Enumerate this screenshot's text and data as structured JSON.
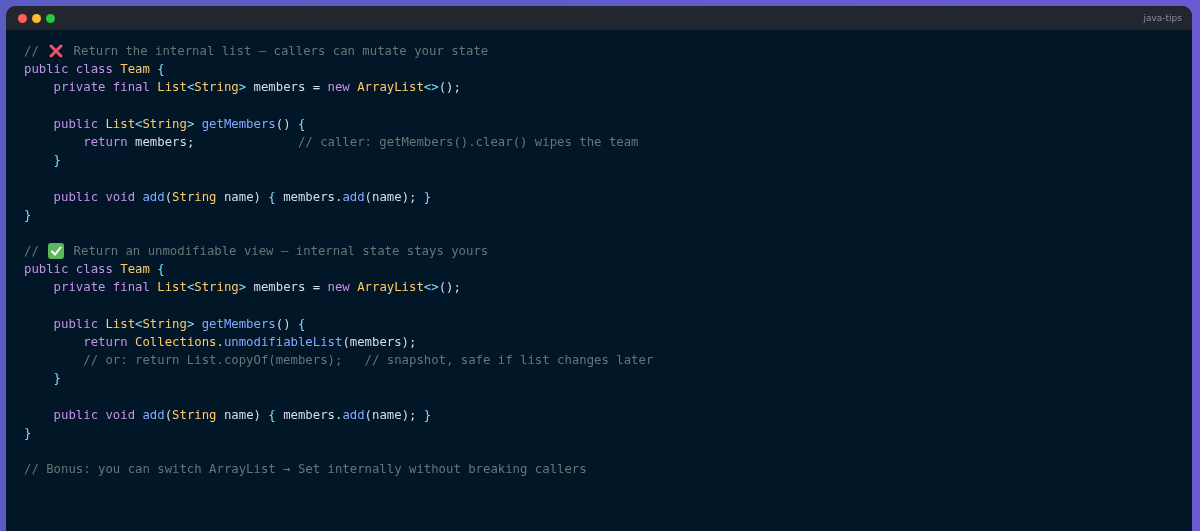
{
  "window": {
    "title": "java-tips"
  },
  "code_blocks": [
    {
      "lines": [
        [
          {
            "kind": "c",
            "text": "// "
          },
          {
            "kind": "cross-icon"
          },
          {
            "kind": "c",
            "text": " Return the internal list — callers can mutate your state"
          }
        ],
        [
          {
            "kind": "k",
            "text": "public class "
          },
          {
            "kind": "t",
            "text": "Team"
          },
          {
            "kind": "p",
            "text": " {"
          }
        ],
        [
          {
            "kind": "k",
            "text": "    private final "
          },
          {
            "kind": "t",
            "text": "List"
          },
          {
            "kind": "p",
            "text": "<"
          },
          {
            "kind": "t",
            "text": "String"
          },
          {
            "kind": "p",
            "text": ">"
          },
          {
            "kind": "n",
            "text": " members = "
          },
          {
            "kind": "k",
            "text": "new "
          },
          {
            "kind": "t",
            "text": "ArrayList"
          },
          {
            "kind": "p",
            "text": "<>"
          },
          {
            "kind": "n",
            "text": "();"
          }
        ]
      ]
    },
    {
      "lines": [
        [
          {
            "kind": "k",
            "text": "    public "
          },
          {
            "kind": "t",
            "text": "List"
          },
          {
            "kind": "p",
            "text": "<"
          },
          {
            "kind": "t",
            "text": "String"
          },
          {
            "kind": "p",
            "text": "> "
          },
          {
            "kind": "f",
            "text": "getMembers"
          },
          {
            "kind": "n",
            "text": "() "
          },
          {
            "kind": "p",
            "text": "{"
          }
        ],
        [
          {
            "kind": "k",
            "text": "        return "
          },
          {
            "kind": "n",
            "text": "members;              "
          },
          {
            "kind": "c",
            "text": "// caller: getMembers().clear() wipes the team"
          }
        ],
        [
          {
            "kind": "p",
            "text": "    }"
          }
        ]
      ]
    },
    {
      "lines": [
        [
          {
            "kind": "k",
            "text": "    public void "
          },
          {
            "kind": "f",
            "text": "add"
          },
          {
            "kind": "n",
            "text": "("
          },
          {
            "kind": "t",
            "text": "String"
          },
          {
            "kind": "n",
            "text": " name) "
          },
          {
            "kind": "p",
            "text": "{"
          },
          {
            "kind": "n",
            "text": " members."
          },
          {
            "kind": "f",
            "text": "add"
          },
          {
            "kind": "n",
            "text": "(name); "
          },
          {
            "kind": "p",
            "text": "}"
          }
        ],
        [
          {
            "kind": "p",
            "text": "}"
          }
        ]
      ]
    },
    {
      "lines": [
        [
          {
            "kind": "c",
            "text": "// "
          },
          {
            "kind": "check-icon"
          },
          {
            "kind": "c",
            "text": " Return an unmodifiable view — internal state stays yours"
          }
        ],
        [
          {
            "kind": "k",
            "text": "public class "
          },
          {
            "kind": "t",
            "text": "Team"
          },
          {
            "kind": "p",
            "text": " {"
          }
        ],
        [
          {
            "kind": "k",
            "text": "    private final "
          },
          {
            "kind": "t",
            "text": "List"
          },
          {
            "kind": "p",
            "text": "<"
          },
          {
            "kind": "t",
            "text": "String"
          },
          {
            "kind": "p",
            "text": ">"
          },
          {
            "kind": "n",
            "text": " members = "
          },
          {
            "kind": "k",
            "text": "new "
          },
          {
            "kind": "t",
            "text": "ArrayList"
          },
          {
            "kind": "p",
            "text": "<>"
          },
          {
            "kind": "n",
            "text": "();"
          }
        ]
      ]
    },
    {
      "lines": [
        [
          {
            "kind": "k",
            "text": "    public "
          },
          {
            "kind": "t",
            "text": "List"
          },
          {
            "kind": "p",
            "text": "<"
          },
          {
            "kind": "t",
            "text": "String"
          },
          {
            "kind": "p",
            "text": "> "
          },
          {
            "kind": "f",
            "text": "getMembers"
          },
          {
            "kind": "n",
            "text": "() "
          },
          {
            "kind": "p",
            "text": "{"
          }
        ],
        [
          {
            "kind": "k",
            "text": "        return "
          },
          {
            "kind": "t",
            "text": "Collections"
          },
          {
            "kind": "n",
            "text": "."
          },
          {
            "kind": "f",
            "text": "unmodifiableList"
          },
          {
            "kind": "n",
            "text": "(members);"
          }
        ],
        [
          {
            "kind": "c",
            "text": "        // or: return List.copyOf(members);   // snapshot, safe if list changes later"
          }
        ],
        [
          {
            "kind": "p",
            "text": "    }"
          }
        ]
      ]
    },
    {
      "lines": [
        [
          {
            "kind": "k",
            "text": "    public void "
          },
          {
            "kind": "f",
            "text": "add"
          },
          {
            "kind": "n",
            "text": "("
          },
          {
            "kind": "t",
            "text": "String"
          },
          {
            "kind": "n",
            "text": " name) "
          },
          {
            "kind": "p",
            "text": "{"
          },
          {
            "kind": "n",
            "text": " members."
          },
          {
            "kind": "f",
            "text": "add"
          },
          {
            "kind": "n",
            "text": "(name); "
          },
          {
            "kind": "p",
            "text": "}"
          }
        ],
        [
          {
            "kind": "p",
            "text": "}"
          }
        ]
      ]
    },
    {
      "lines": [
        [
          {
            "kind": "c",
            "text": "// Bonus: you can switch ArrayList → Set internally without breaking callers"
          }
        ]
      ]
    }
  ]
}
